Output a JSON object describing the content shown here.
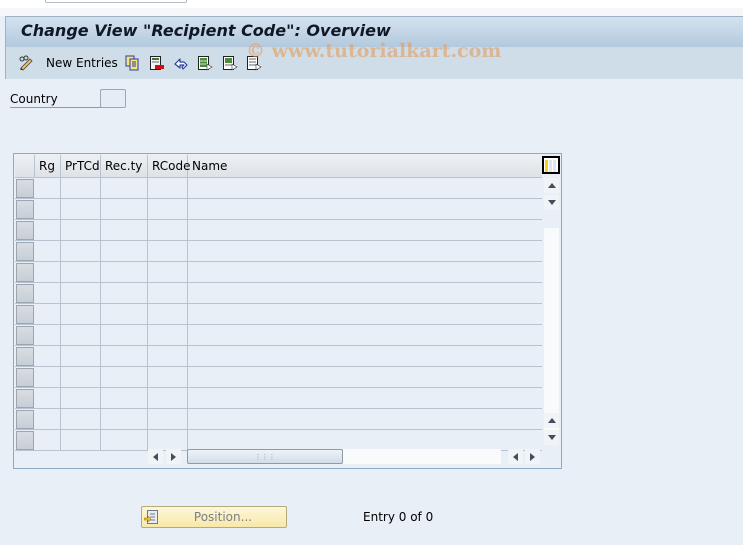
{
  "window": {
    "title": "Change View \"Recipient Code\": Overview"
  },
  "toolbar": {
    "items": [
      {
        "name": "change-display-icon",
        "label": ""
      },
      {
        "name": "new-entries-button",
        "label": "New Entries"
      },
      {
        "name": "copy-as-icon",
        "label": ""
      },
      {
        "name": "delete-icon",
        "label": ""
      },
      {
        "name": "undo-change-icon",
        "label": ""
      },
      {
        "name": "select-all-icon",
        "label": ""
      },
      {
        "name": "select-block-icon",
        "label": ""
      },
      {
        "name": "deselect-all-icon",
        "label": ""
      }
    ],
    "new_entries_label": "New Entries"
  },
  "watermark": "© www.tutorialkart.com",
  "filter": {
    "country_label": "Country",
    "country_value": ""
  },
  "table": {
    "columns": [
      "Rg",
      "PrTCd",
      "Rec.ty",
      "RCode",
      "Name"
    ],
    "row_count_visible": 13,
    "rows": []
  },
  "footer": {
    "position_button_label": "Position...",
    "entry_status": "Entry 0 of 0"
  }
}
